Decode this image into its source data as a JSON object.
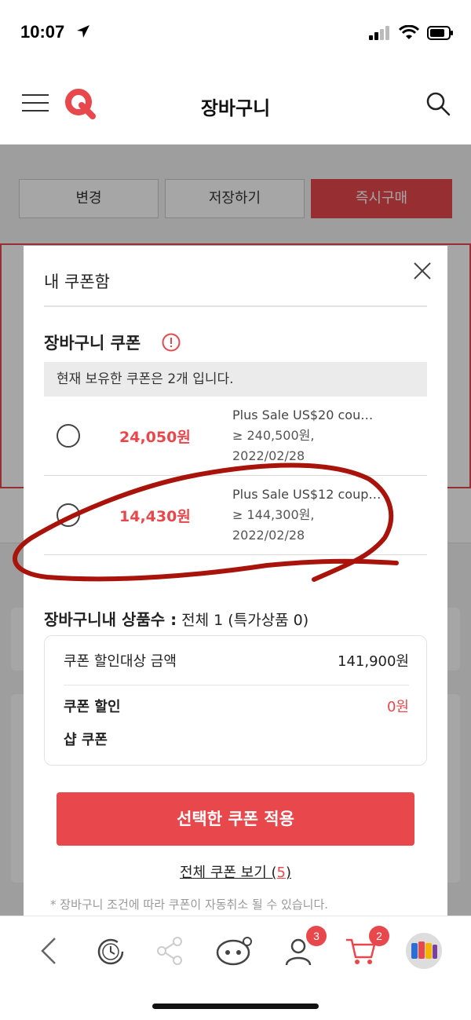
{
  "status_bar": {
    "time": "10:07"
  },
  "header": {
    "title": "장바구니",
    "logo": "Q"
  },
  "background": {
    "buttons": [
      "변경",
      "저장하기",
      "즉시구매"
    ]
  },
  "modal": {
    "title": "내 쿠폰함",
    "coupon_section": {
      "heading": "장바구니 쿠폰",
      "count_text": "현재 보유한 쿠폰은 2개 입니다.",
      "coupons": [
        {
          "amount": "24,050원",
          "name": "Plus Sale US$20 cou…",
          "condition": "≥ 240,500원,",
          "date": "2022/02/28"
        },
        {
          "amount": "14,430원",
          "name": "Plus Sale US$12 coup…",
          "condition": "≥ 144,300원,",
          "date": "2022/02/28"
        }
      ]
    },
    "cart_count": {
      "label": "장바구니내 상품수 :",
      "value": "전체 1 (특가상품 0)"
    },
    "summary": {
      "target_label": "쿠폰 할인대상 금액",
      "target_value": "141,900원",
      "discount_label": "쿠폰 할인",
      "discount_value": "0원",
      "shop_label": "샵 쿠폰"
    },
    "apply_label": "선택한 쿠폰 적용",
    "view_all_label": "전체 쿠폰 보기 (",
    "view_all_count": "5",
    "view_all_close": ")",
    "notice": "* 장바구니 조건에 따라 쿠폰이 자동취소 될 수 있습니다."
  },
  "bottom_nav": {
    "profile_badge": "3",
    "cart_badge": "2"
  },
  "colors": {
    "accent": "#e8474c",
    "annotation": "#a8140c"
  }
}
